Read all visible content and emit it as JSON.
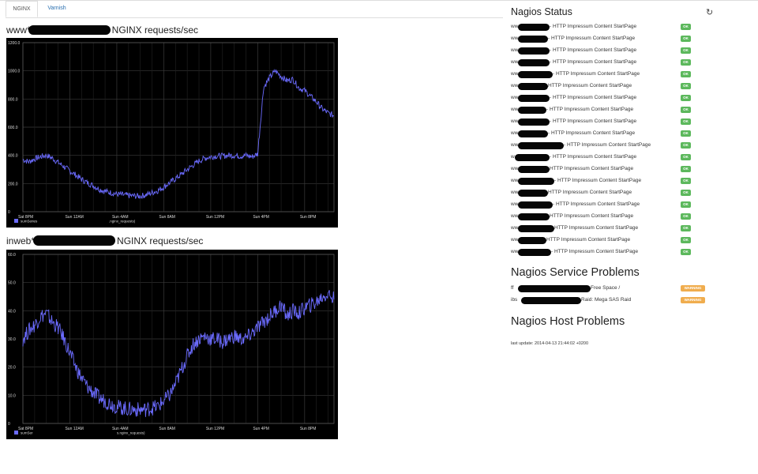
{
  "tabs": [
    {
      "label": "NGINX",
      "active": true
    },
    {
      "label": "Varnish",
      "active": false
    }
  ],
  "graphs": [
    {
      "title_prefix": "www*",
      "title_suffix": "NGINX requests/sec",
      "legend": [
        "sumSeries",
        ".nginx_requests)"
      ],
      "chart_data": {
        "type": "line",
        "title": "",
        "x_ticks": [
          "Sat 8PM",
          "Sun 12AM",
          "Sun 4AM",
          "Sun 8AM",
          "Sun 12PM",
          "Sun 4PM",
          "Sun 8PM"
        ],
        "y_ticks": [
          "0",
          "200.0",
          "400.0",
          "600.0",
          "800.0",
          "1000.0",
          "1200.0"
        ],
        "ylim": [
          0,
          1200
        ],
        "grid": true,
        "line_color": "#6b6bff",
        "series": [
          {
            "x_hours": [
              0,
              0.5,
              1,
              1.5,
              2,
              2.5,
              3,
              3.5,
              4,
              4.5,
              5,
              5.5,
              6,
              6.5,
              7,
              7.5,
              8,
              8.5,
              9,
              9.5,
              10,
              10.5,
              11,
              11.5,
              12,
              12.5,
              13,
              13.5,
              14,
              14.5,
              15,
              15.5,
              16,
              16.5,
              17,
              17.5,
              18,
              18.5,
              19,
              19.5,
              20,
              20.5,
              21,
              21.5,
              22,
              22.5,
              23,
              23.5,
              24,
              24.5,
              25,
              25.5,
              26,
              26.5
            ],
            "values": [
              370,
              355,
              375,
              390,
              400,
              380,
              350,
              320,
              290,
              260,
              230,
              205,
              185,
              160,
              145,
              135,
              125,
              120,
              115,
              112,
              110,
              120,
              135,
              150,
              175,
              205,
              235,
              265,
              300,
              330,
              360,
              380,
              390,
              395,
              395,
              400,
              400,
              395,
              400,
              390,
              410,
              880,
              950,
              1000,
              960,
              930,
              940,
              880,
              860,
              820,
              780,
              730,
              700,
              680
            ]
          }
        ]
      }
    },
    {
      "title_prefix": "inweb*",
      "title_suffix": "NGINX requests/sec",
      "legend": [
        "sumSer",
        "s.nginx_requests)"
      ],
      "chart_data": {
        "type": "line",
        "title": "",
        "x_ticks": [
          "Sat 8PM",
          "Sun 12AM",
          "Sun 4AM",
          "Sun 8AM",
          "Sun 12PM",
          "Sun 4PM",
          "Sun 8PM"
        ],
        "y_ticks": [
          "0",
          "10.0",
          "20.0",
          "30.0",
          "40.0",
          "50.0",
          "60.0"
        ],
        "ylim": [
          0,
          60
        ],
        "grid": true,
        "line_color": "#6b6bff",
        "series": [
          {
            "x_hours": [
              0,
              0.5,
              1,
              1.5,
              2,
              2.5,
              3,
              3.5,
              4,
              4.5,
              5,
              5.5,
              6,
              6.5,
              7,
              7.5,
              8,
              8.5,
              9,
              9.5,
              10,
              10.5,
              11,
              11.5,
              12,
              12.5,
              13,
              13.5,
              14,
              14.5,
              15,
              15.5,
              16,
              16.5,
              17,
              17.5,
              18,
              18.5,
              19,
              19.5,
              20,
              20.5,
              21,
              21.5,
              22,
              22.5,
              23,
              23.5,
              24,
              24.5,
              25,
              25.5,
              26,
              26.5
            ],
            "values": [
              30,
              33,
              35,
              38,
              39,
              36,
              34,
              30,
              25,
              20,
              16,
              13,
              11,
              9,
              8,
              7,
              6,
              5.5,
              5,
              5,
              4.8,
              5,
              5.5,
              6,
              8,
              10,
              14,
              19,
              24,
              28,
              30,
              31,
              30,
              30,
              29,
              30,
              31,
              30,
              30,
              32,
              34,
              36,
              38,
              40,
              42,
              38,
              40,
              39,
              41,
              42,
              43,
              45,
              46,
              44
            ]
          }
        ]
      }
    }
  ],
  "nagios_status": {
    "title": "Nagios Status",
    "refresh_icon": "refresh-icon",
    "rows": [
      {
        "prefix": "ww",
        "desc": " - HTTP Impressum Content StartPage",
        "status": "OK"
      },
      {
        "prefix": "ww",
        "desc": " - HTTP Impressum Content StartPage",
        "status": "OK"
      },
      {
        "prefix": "ww",
        "desc": " - HTTP Impressum Content StartPage",
        "status": "OK"
      },
      {
        "prefix": "ww",
        "desc": " - HTTP Impressum Content StartPage",
        "status": "OK"
      },
      {
        "prefix": "ww",
        "desc": " - HTTP Impressum Content StartPage",
        "status": "OK"
      },
      {
        "prefix": "ww",
        "desc": " HTTP Impressum Content StartPage",
        "status": "OK"
      },
      {
        "prefix": "ww",
        "desc": " - HTTP Impressum Content StartPage",
        "status": "OK"
      },
      {
        "prefix": "ww",
        "desc": " - HTTP Impressum Content StartPage",
        "status": "OK"
      },
      {
        "prefix": "ww",
        "desc": " - HTTP Impressum Content StartPage",
        "status": "OK"
      },
      {
        "prefix": "ww",
        "desc": " - HTTP Impressum Content StartPage",
        "status": "OK"
      },
      {
        "prefix": "ww",
        "desc": " - HTTP Impressum Content StartPage",
        "status": "OK"
      },
      {
        "prefix": "w",
        "desc": " - HTTP Impressum Content StartPage",
        "status": "OK"
      },
      {
        "prefix": "ww",
        "desc": " HTTP Impressum Content StartPage",
        "status": "OK"
      },
      {
        "prefix": "ww",
        "desc": " - HTTP Impressum Content StartPage",
        "status": "OK"
      },
      {
        "prefix": "ww",
        "desc": " HTTP Impressum Content StartPage",
        "status": "OK"
      },
      {
        "prefix": "ww",
        "desc": " - HTTP Impressum Content StartPage",
        "status": "OK"
      },
      {
        "prefix": "ww",
        "desc": " HTTP Impressum Content StartPage",
        "status": "OK"
      },
      {
        "prefix": "ww",
        "desc": " HTTP Impressum Content StartPage",
        "status": "OK"
      },
      {
        "prefix": "ww",
        "desc": " HTTP Impressum Content StartPage",
        "status": "OK"
      },
      {
        "prefix": "ww",
        "desc": " - HTTP Impressum Content StartPage",
        "status": "OK"
      }
    ]
  },
  "service_problems": {
    "title": "Nagios Service Problems",
    "rows": [
      {
        "prefix": "ff",
        "desc": " Free Space /",
        "status": "WARNING"
      },
      {
        "prefix": "ibs",
        "desc": " Raid: Mega SAS Raid",
        "status": "WARNING"
      }
    ]
  },
  "host_problems": {
    "title": "Nagios Host Problems"
  },
  "last_update": "last update: 2014-04-13 21:44:02 +0200"
}
